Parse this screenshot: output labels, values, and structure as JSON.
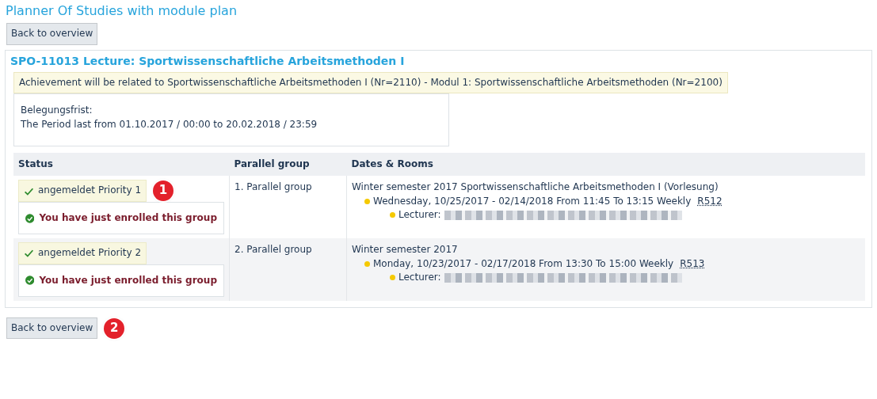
{
  "page_title": "Planner Of Studies with module plan",
  "back_button_top": "Back to overview",
  "lecture": {
    "title": "SPO-11013 Lecture: Sportwissenschaftliche Arbeitsmethoden I",
    "achievement_note": "Achievement will be related to Sportwissenschaftliche Arbeitsmethoden I (Nr=2110) - Modul 1: Sportwissenschaftliche Arbeitsmethoden (Nr=2100)",
    "deadline_label": "Belegungsfrist:",
    "deadline_text": "The Period last from 01.10.2017 / 00:00 to 20.02.2018 / 23:59",
    "table": {
      "columns": [
        "Status",
        "Parallel group",
        "Dates & Rooms"
      ],
      "rows": [
        {
          "status": "angemeldet Priority 1",
          "callout": "1",
          "message": "You have just enrolled this group",
          "group": "1. Parallel group",
          "semester": "Winter semester 2017 Sportwissenschaftliche Arbeitsmethoden I (Vorlesung)",
          "date": "Wednesday, 10/25/2017 - 02/14/2018 From 11:45 To 13:15 Weekly",
          "room": "R512",
          "lecturer_label": "Lecturer:"
        },
        {
          "status": "angemeldet Priority 2",
          "message": "You have just enrolled this group",
          "group": "2. Parallel group",
          "semester": "Winter semester 2017",
          "date": "Monday, 10/23/2017 - 02/17/2018 From 13:30 To 15:00 Weekly",
          "room": "R513",
          "lecturer_label": "Lecturer:"
        }
      ]
    }
  },
  "back_button_bottom": "Back to overview",
  "bottom_callout": "2"
}
